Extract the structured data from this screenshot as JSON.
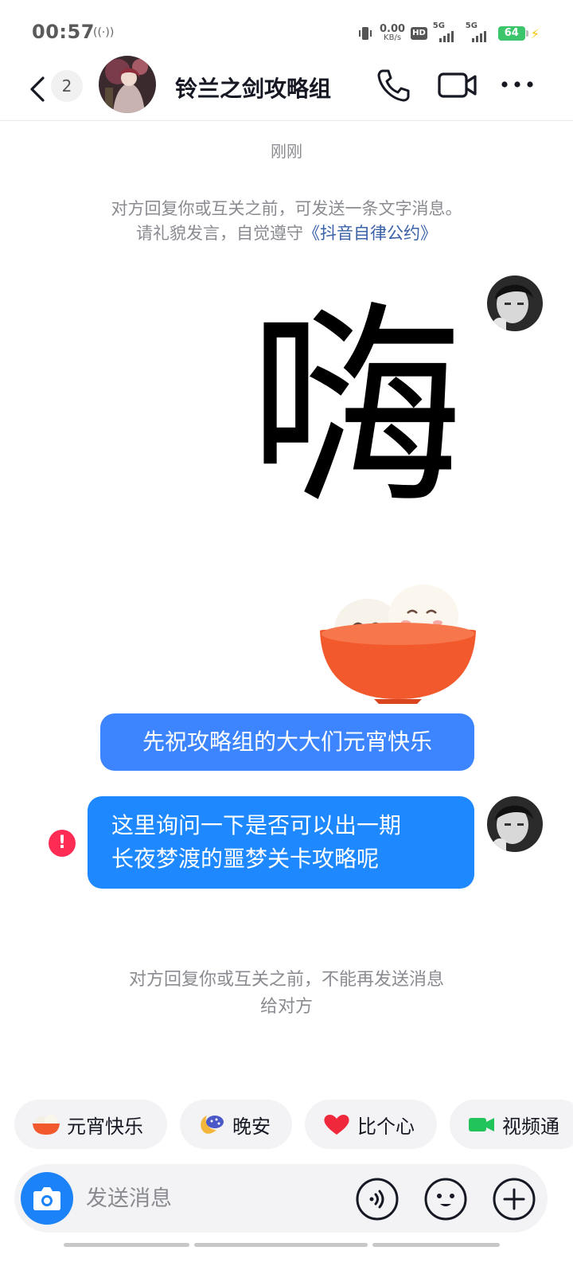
{
  "status_bar": {
    "time": "00:57",
    "net_speed_value": "0.00",
    "net_speed_unit": "KB/s",
    "hd_label": "HD",
    "signal1_label": "5G",
    "signal2_label": "5G",
    "battery": "64"
  },
  "header": {
    "unread_count": "2",
    "title": "铃兰之剑攻略组"
  },
  "messages": {
    "timestamp": "刚刚",
    "notice_line1": "对方回复你或互关之前，可发送一条文字消息。",
    "notice_line2_prefix": "请礼貌发言，自觉遵守",
    "notice_link": "《抖音自律公约》",
    "sticker_text": "嗨",
    "bubble1": "先祝攻略组的大大们元宵快乐",
    "bubble2_line1": "这里询问一下是否可以出一期",
    "bubble2_line2": "长夜梦渡的噩梦关卡攻略呢",
    "error_mark": "!",
    "notice2_line1": "对方回复你或互关之前，不能再发送消息",
    "notice2_line2": "给对方"
  },
  "quick_replies": [
    {
      "label": "元宵快乐",
      "icon": "tangyuan-bowl-icon"
    },
    {
      "label": "晚安",
      "icon": "moon-night-icon"
    },
    {
      "label": "比个心",
      "icon": "heart-icon"
    },
    {
      "label": "视频通",
      "icon": "video-camera-icon"
    }
  ],
  "input": {
    "placeholder": "发送消息"
  },
  "colors": {
    "bubble": "#2b7cff",
    "link": "#3a62a8",
    "error": "#fe2c55",
    "camera_button": "#1b82f7"
  }
}
